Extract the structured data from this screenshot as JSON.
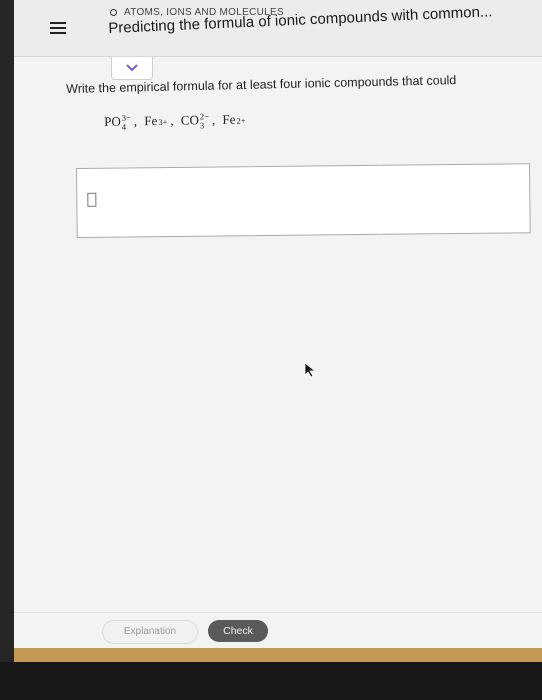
{
  "header": {
    "topic": "ATOMS, IONS AND MOLECULES",
    "title": "Predicting the formula of ionic compounds with common..."
  },
  "question": {
    "prompt": "Write the empirical formula for at least four ionic compounds that could",
    "ions": [
      {
        "base": "PO",
        "charge": "3−",
        "subscript": "4"
      },
      {
        "base": "Fe",
        "charge": "3+",
        "subscript": ""
      },
      {
        "base": "CO",
        "charge": "2−",
        "subscript": "3"
      },
      {
        "base": "Fe",
        "charge": "2+",
        "subscript": ""
      }
    ],
    "separator": ","
  },
  "answer": {
    "value": ""
  },
  "footer": {
    "explanation_label": "Explanation",
    "check_label": "Check"
  },
  "colors": {
    "accent_bar": "#c29a55",
    "check_button": "#5a5a5a"
  },
  "icons": {
    "menu": "hamburger-icon",
    "topic_indicator": "circle-icon",
    "collapse": "chevron-down-icon",
    "pointer": "mouse-cursor-icon"
  }
}
